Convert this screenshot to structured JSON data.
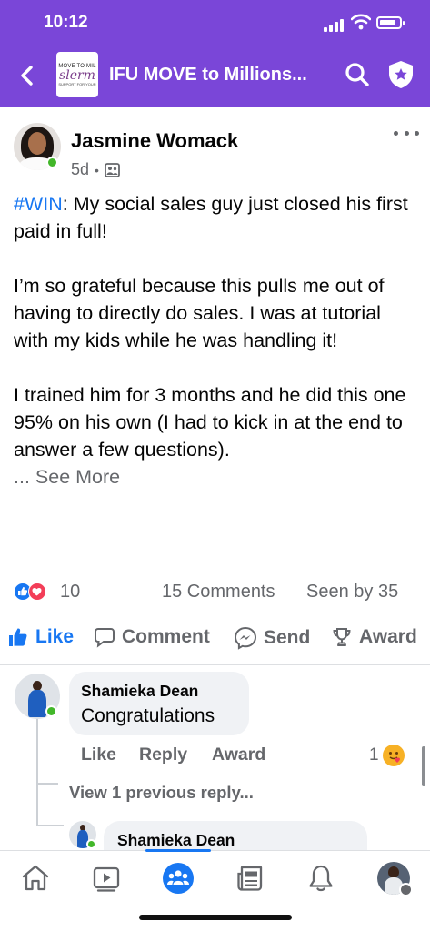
{
  "status_bar": {
    "time": "10:12"
  },
  "header": {
    "title": "IFU MOVE to Millions...",
    "logo_line1": "MOVE TO MIL",
    "logo_line2": "slerm",
    "logo_line3": "SUPPORT FOR YOUR"
  },
  "post": {
    "author": "Jasmine Womack",
    "time": "5d",
    "hashtag": "#WIN",
    "paragraph1": ": My social sales guy just closed his first paid in full!",
    "paragraph2": "I’m so grateful because this pulls me out of having to directly do sales. I was at tutorial with my kids while he was handling it!",
    "paragraph3": "I trained him for 3 months and he did this one 95% on his own (I had to kick in at the end to answer a few questions).",
    "ellipsis": "... ",
    "see_more": "See More",
    "reaction_count": "10",
    "comments_count": "15 Comments",
    "seen_by": "Seen by 35"
  },
  "actions": {
    "like": "Like",
    "comment": "Comment",
    "send": "Send",
    "award": "Award"
  },
  "comments": [
    {
      "name": "Shamieka Dean",
      "text": "Congratulations",
      "like": "Like",
      "reply": "Reply",
      "award": "Award",
      "reaction_count": "1"
    }
  ],
  "view_previous": "View 1 previous reply...",
  "reply": {
    "name": "Shamieka Dean"
  },
  "colors": {
    "header_bg": "#7a46d8",
    "accent": "#1877f2",
    "muted": "#65676b",
    "online": "#42b72a",
    "bubble": "#f0f2f5"
  },
  "tabbar": {
    "icons": [
      "home-icon",
      "video-icon",
      "groups-icon",
      "news-icon",
      "bell-icon",
      "profile-avatar"
    ],
    "active": "groups-icon"
  }
}
